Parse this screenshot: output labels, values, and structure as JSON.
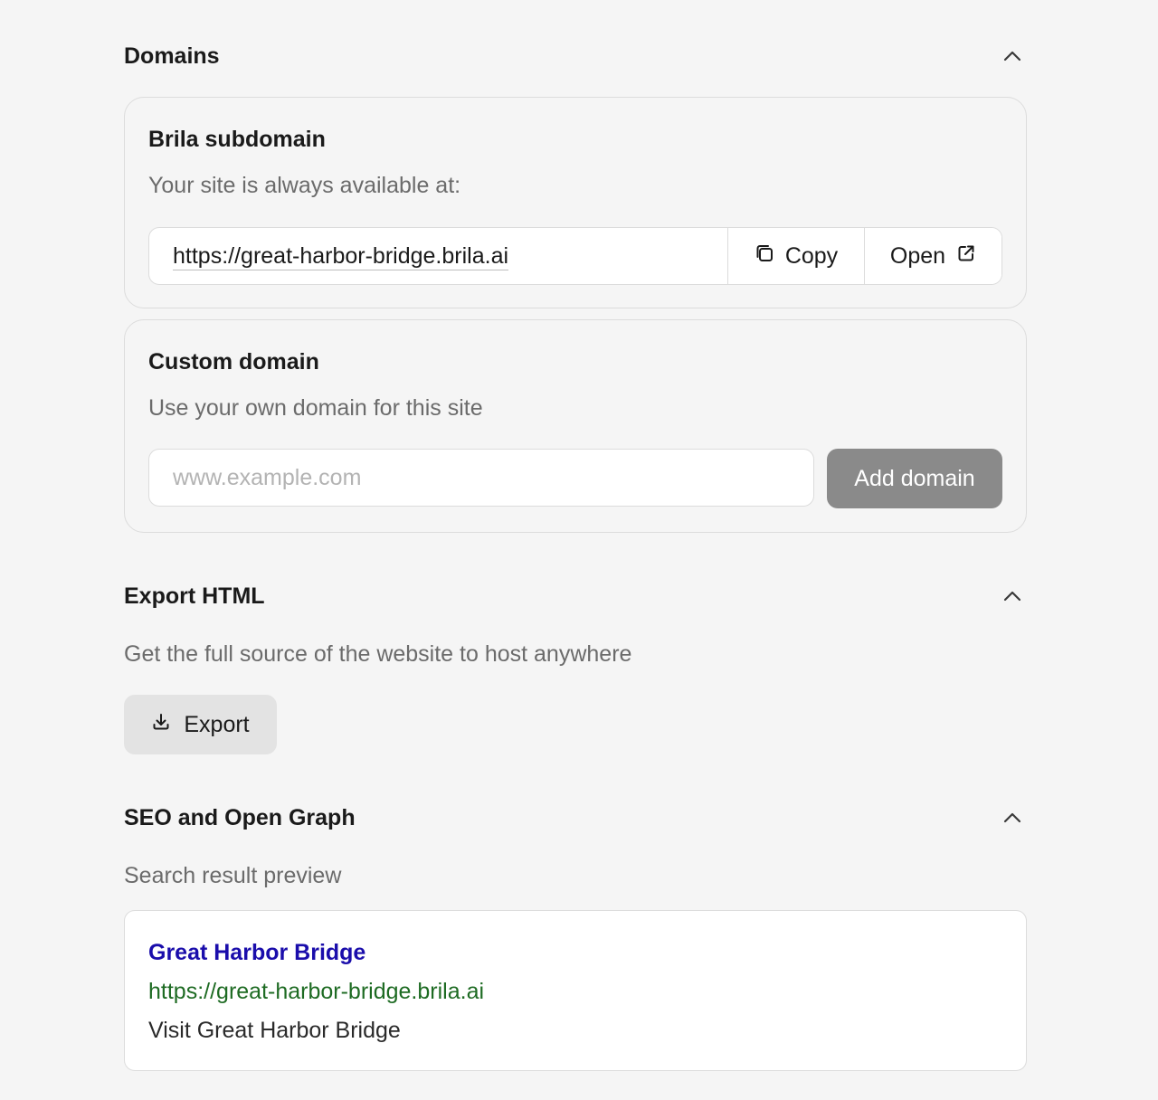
{
  "domains": {
    "title": "Domains",
    "subdomain": {
      "title": "Brila subdomain",
      "description": "Your site is always available at:",
      "url": "https://great-harbor-bridge.brila.ai",
      "copy_label": "Copy",
      "open_label": "Open"
    },
    "custom": {
      "title": "Custom domain",
      "description": "Use your own domain for this site",
      "placeholder": "www.example.com",
      "value": "",
      "add_label": "Add domain"
    }
  },
  "export": {
    "title": "Export HTML",
    "description": "Get the full source of the website to host anywhere",
    "button_label": "Export"
  },
  "seo": {
    "title": "SEO and Open Graph",
    "preview_label": "Search result preview",
    "preview": {
      "title": "Great Harbor Bridge",
      "url": "https://great-harbor-bridge.brila.ai",
      "description": "Visit Great Harbor Bridge"
    }
  },
  "icons": {
    "collapse": "chevron-up-icon",
    "copy": "copy-icon",
    "open": "external-link-icon",
    "export": "download-icon"
  },
  "colors": {
    "background": "#f5f5f5",
    "add_button": "#8a8a8a",
    "export_button": "#e3e3e3",
    "preview_title": "#1a0dab",
    "preview_url": "#1e6b23"
  }
}
